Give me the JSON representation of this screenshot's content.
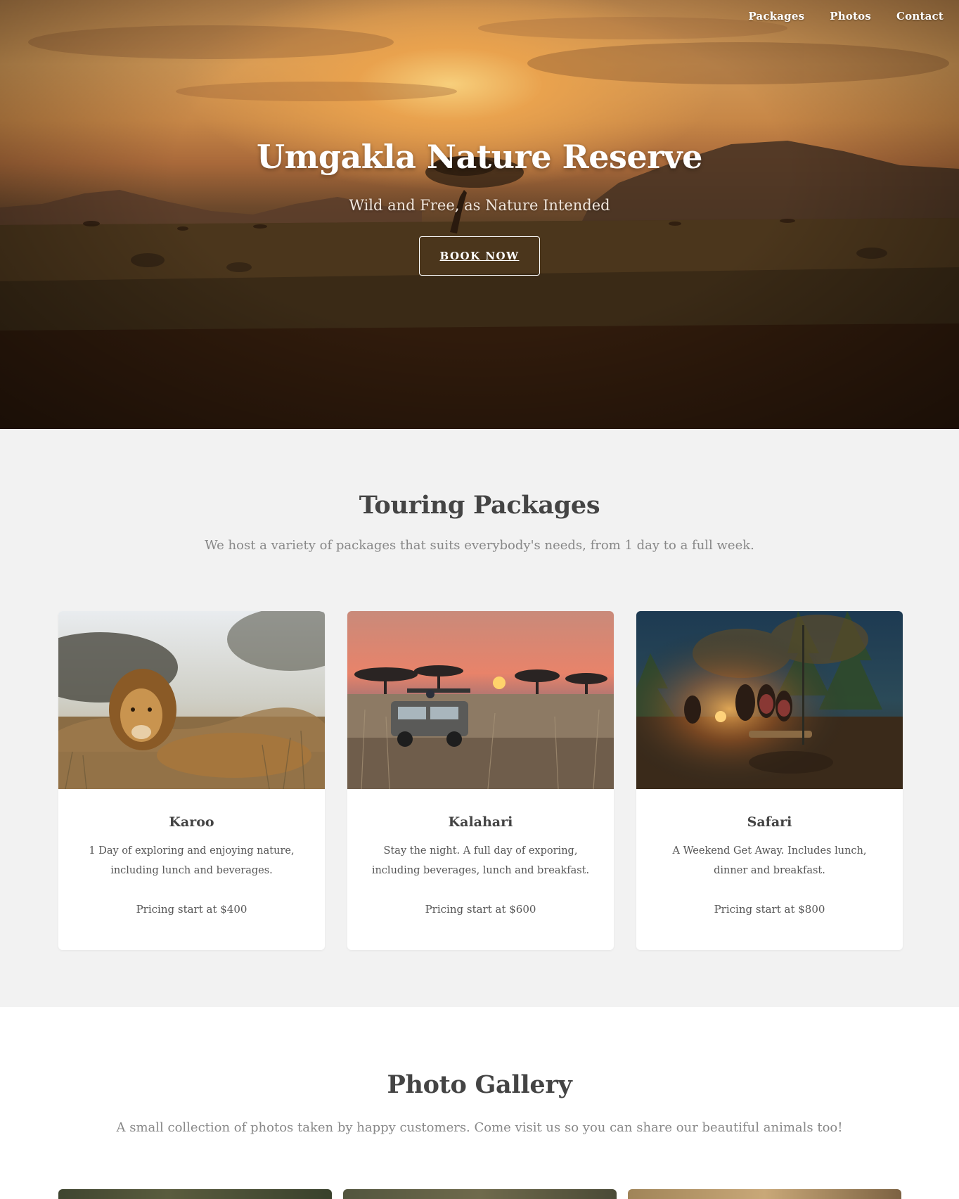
{
  "nav": {
    "items": [
      {
        "label": "Packages"
      },
      {
        "label": "Photos"
      },
      {
        "label": "Contact"
      }
    ]
  },
  "hero": {
    "title": "Umgakla Nature Reserve",
    "subtitle": "Wild and Free, as Nature Intended",
    "cta_label": "BOOK NOW"
  },
  "packages": {
    "title": "Touring Packages",
    "subtitle": "We host a variety of packages that suits everybody's needs, from 1 day to a full week.",
    "cards": [
      {
        "title": "Karoo",
        "description": "1 Day of exploring and enjoying nature, including lunch and beverages.",
        "price": "Pricing start at $400"
      },
      {
        "title": "Kalahari",
        "description": "Stay the night. A full day of exporing, including beverages, lunch and breakfast.",
        "price": "Pricing start at $600"
      },
      {
        "title": "Safari",
        "description": "A Weekend Get Away. Includes lunch, dinner and breakfast.",
        "price": "Pricing start at $800"
      }
    ]
  },
  "gallery": {
    "title": "Photo Gallery",
    "subtitle": "A small collection of photos taken by happy customers. Come visit us so you can share our beautiful animals too!"
  },
  "colors": {
    "section_bg": "#f2f2f2",
    "heading": "#444444",
    "muted": "#888888",
    "hero_accent": "#e9a24e"
  }
}
